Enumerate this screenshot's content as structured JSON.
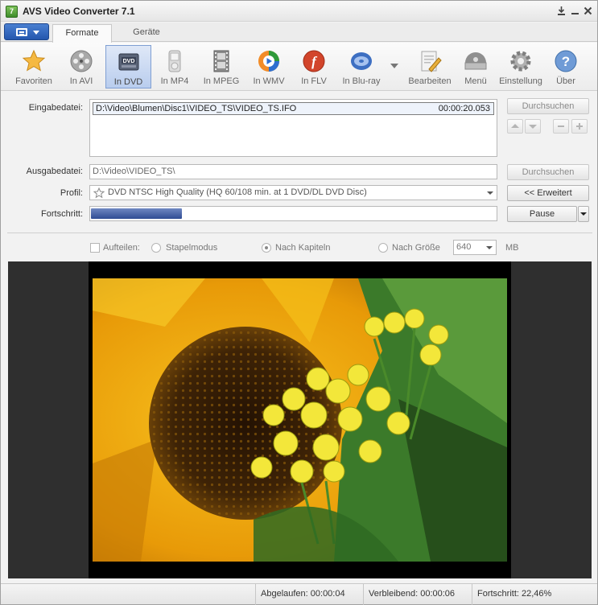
{
  "window": {
    "title": "AVS Video Converter 7.1",
    "icon": "avs-app-icon",
    "controls": [
      "download-icon",
      "minimize-icon",
      "close-icon"
    ]
  },
  "tabs": [
    {
      "label": "Formate",
      "active": true
    },
    {
      "label": "Geräte",
      "active": false
    }
  ],
  "toolbar": {
    "items": [
      {
        "label": "Favoriten",
        "icon": "star-icon"
      },
      {
        "label": "In AVI",
        "icon": "film-reel-icon"
      },
      {
        "label": "In DVD",
        "icon": "dvd-icon",
        "active": true
      },
      {
        "label": "In MP4",
        "icon": "mp4-player-icon"
      },
      {
        "label": "In MPEG",
        "icon": "film-strip-icon"
      },
      {
        "label": "In WMV",
        "icon": "wmv-icon"
      },
      {
        "label": "In FLV",
        "icon": "flash-icon"
      },
      {
        "label": "In Blu-ray",
        "icon": "blu-ray-icon"
      },
      {
        "label": "Bearbeiten",
        "icon": "edit-icon"
      },
      {
        "label": "Menü",
        "icon": "disc-menu-icon"
      },
      {
        "label": "Einstellung",
        "icon": "gear-icon"
      },
      {
        "label": "Über",
        "icon": "help-icon"
      }
    ]
  },
  "input": {
    "label": "Eingabedatei:",
    "files": [
      {
        "path": "D:\\Video\\Blumen\\Disc1\\VIDEO_TS\\VIDEO_TS.IFO",
        "duration": "00:00:20.053"
      }
    ],
    "browse_label": "Durchsuchen"
  },
  "output": {
    "label": "Ausgabedatei:",
    "value": "D:\\Video\\VIDEO_TS\\",
    "browse_label": "Durchsuchen"
  },
  "profile": {
    "label": "Profil:",
    "value": "DVD NTSC High Quality (HQ 60/108 min. at 1 DVD/DL DVD Disc)",
    "advanced_label": "<< Erweitert"
  },
  "progress": {
    "label": "Fortschritt:",
    "fraction": 0.2246,
    "pause_label": "Pause"
  },
  "split": {
    "split_label": "Aufteilen:",
    "batch_label": "Stapelmodus",
    "chapters_label": "Nach Kapiteln",
    "size_label": "Nach Größe",
    "size_value": "640",
    "size_unit": "MB"
  },
  "status": {
    "elapsed": "Abgelaufen: 00:00:04",
    "remaining": "Verbleibend: 00:00:06",
    "progress": "Fortschritt: 22,46%"
  },
  "colors": {
    "accent": "#2457ae",
    "progress_fill": "#3a5599",
    "preview_bg": "#2f2f2f"
  }
}
